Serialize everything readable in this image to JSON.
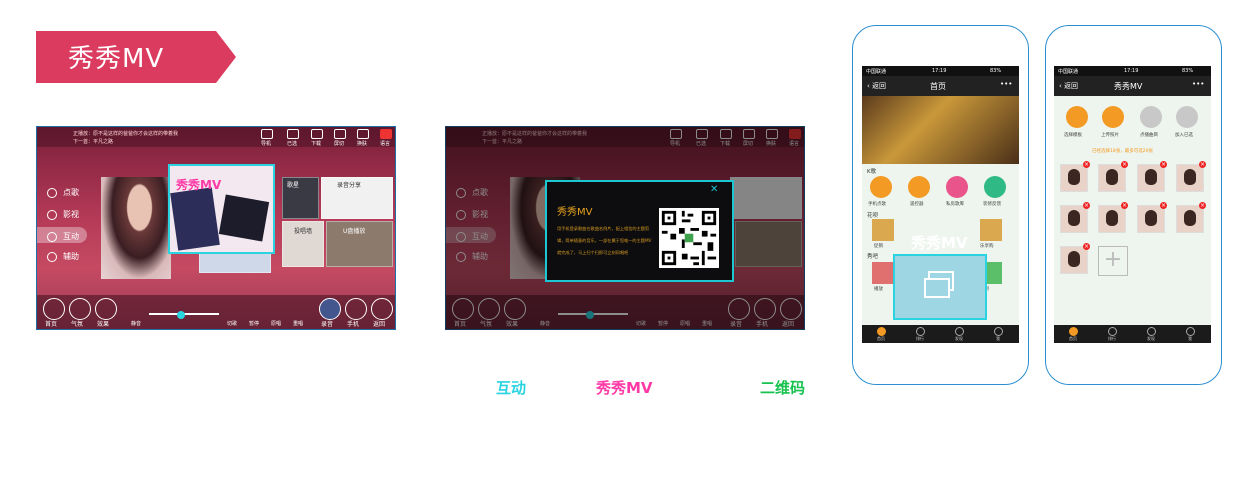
{
  "title": "秀秀MV",
  "colors": {
    "ribbon": "#db3b5f",
    "accent_cyan": "#29d4e0",
    "accent_pink": "#ff3aa6",
    "accent_green": "#17c24f",
    "phone_border": "#2b8fd1",
    "qr_text": "#d79a21"
  },
  "tv": {
    "now_playing": "正播放：原不是这样的爸爸你才会这样的带着我",
    "next_song": "下一首：平凡之路",
    "top_icons": [
      "导机",
      "已选",
      "下载",
      "屏切",
      "换肤",
      "语言"
    ],
    "side_menu": [
      "点歌",
      "影视",
      "互动",
      "辅助"
    ],
    "bottom_buttons": [
      "首页",
      "气氛",
      "效果"
    ],
    "volume_label": "静音",
    "playback": [
      "切歌",
      "暂停",
      "原唱",
      "重唱"
    ],
    "right_buttons": [
      "录音",
      "手机",
      "返回"
    ],
    "tiles": [
      "歌星",
      "录音分享",
      "投唱墙",
      "U盘播放"
    ]
  },
  "popup_mv": {
    "title": "秀秀MV"
  },
  "popup_qr": {
    "title": "秀秀MV",
    "description": "用手机登录歌曲在歌曲名例片，配上相信的主题剪辑，简单随意的音乐，一部在属于您唯一的主题MV就完成了，马上扫个扫即可立刻同唱吧"
  },
  "captions": [
    "互动",
    "秀秀MV",
    "二维码"
  ],
  "phone1": {
    "status_carrier": "中国联通",
    "time": "17:19",
    "battery": "83%",
    "back": "返回",
    "title": "首页",
    "more": "•••",
    "section_k": "K歌",
    "k_items": [
      "手机点歌",
      "遥控器",
      "私房歌库",
      "装修反馈"
    ],
    "section_flower": "花呗",
    "flower_items": [
      "促销",
      "",
      "",
      "乐享购"
    ],
    "section_show": "秀吧",
    "show_items": [
      "播放",
      "",
      "",
      "原创"
    ],
    "overlay_title": "秀秀MV",
    "tabs": [
      "首页",
      "排行",
      "发现",
      "我"
    ]
  },
  "phone2": {
    "status_carrier": "中国联通",
    "time": "17:19",
    "battery": "83%",
    "back": "返回",
    "title": "秀秀MV",
    "more": "•••",
    "steps": [
      "选择模板",
      "上传照片",
      "点播曲目",
      "加入已选"
    ],
    "hint": "已经选择18张，最多可选20张",
    "tabs": [
      "首页",
      "排行",
      "发现",
      "我"
    ]
  }
}
